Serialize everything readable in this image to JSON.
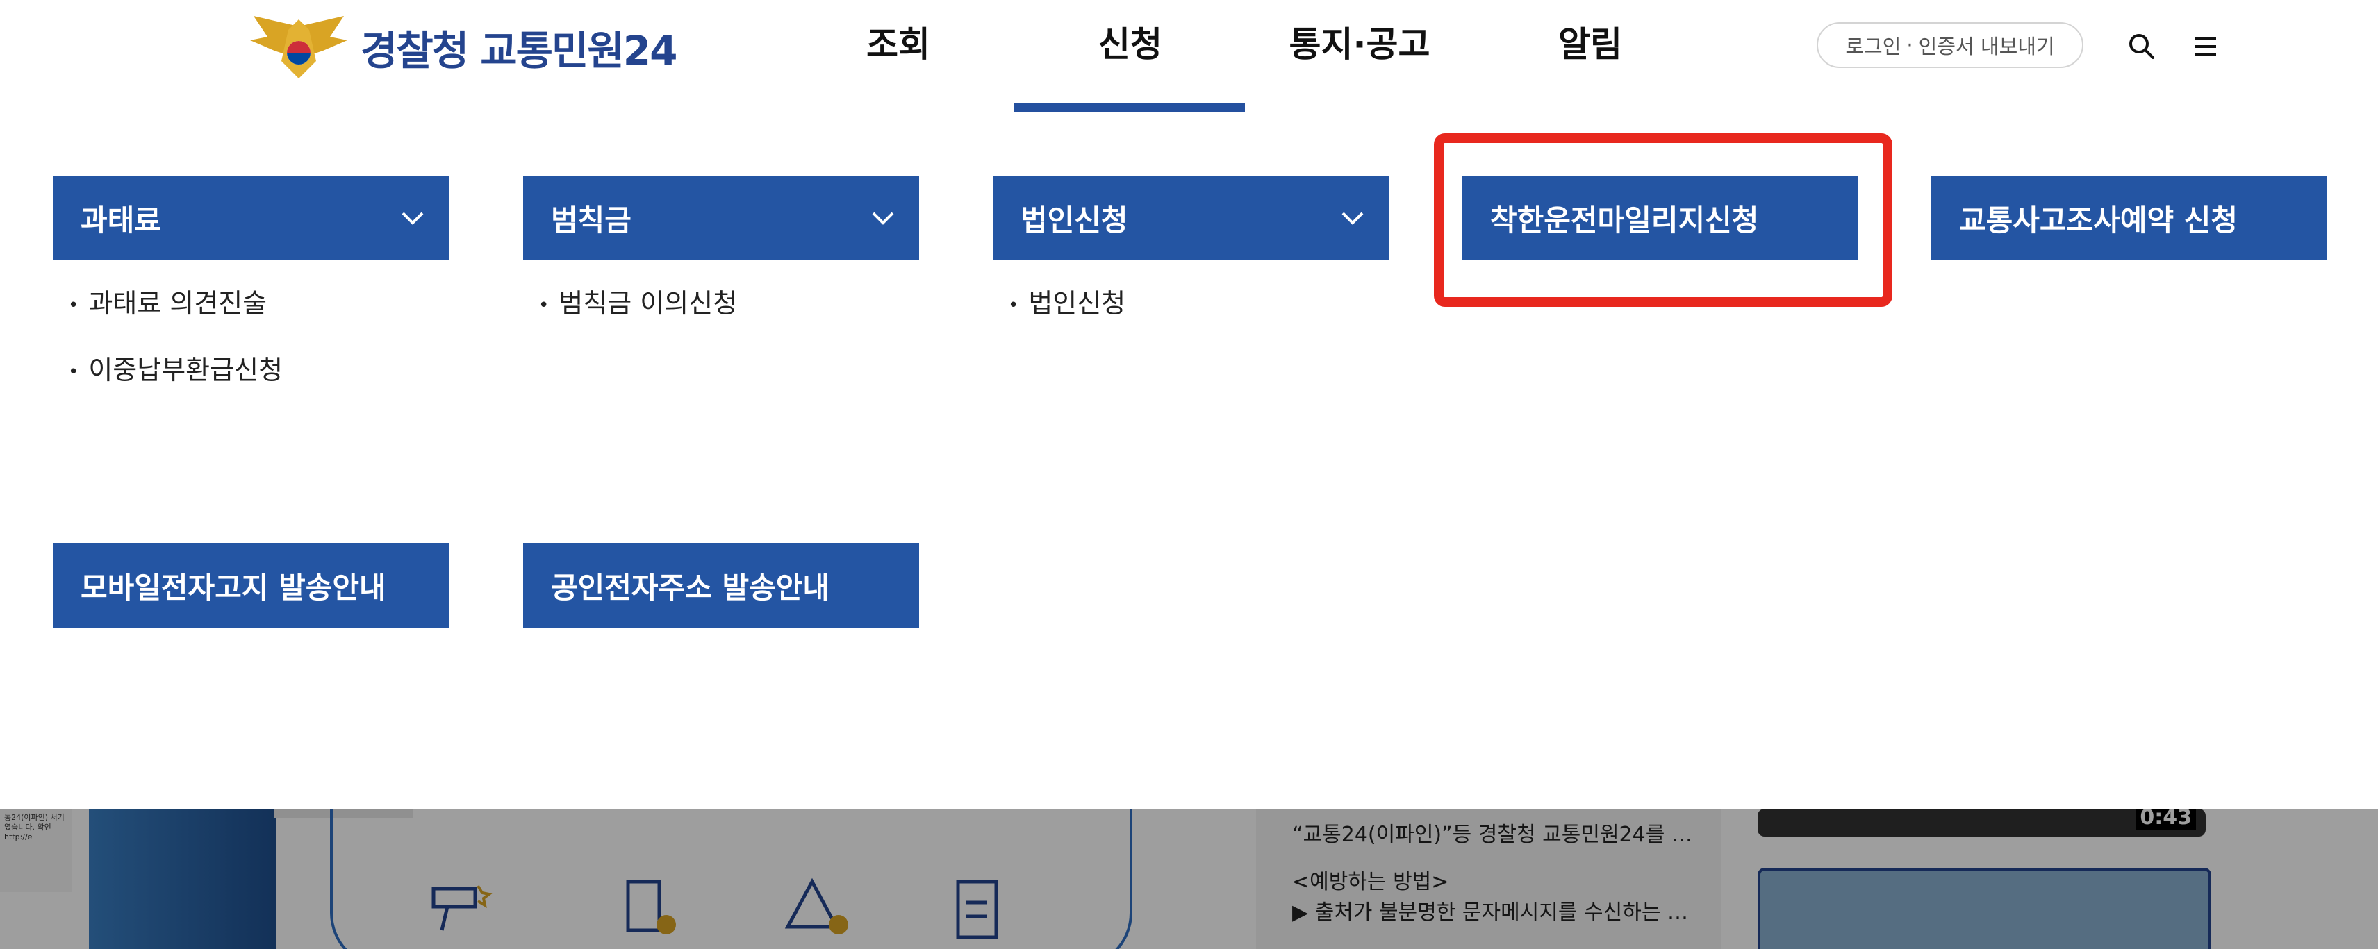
{
  "header": {
    "logo_text": "경찰청 교통민원24",
    "nav": [
      {
        "label": "조회"
      },
      {
        "label": "신청"
      },
      {
        "label": "통지·공고"
      },
      {
        "label": "알림"
      }
    ],
    "active_nav": "신청",
    "login_label": "로그인",
    "cert_label": "인증서 내보내기"
  },
  "mega_menu": {
    "row1": [
      {
        "title": "과태료",
        "items": [
          "과태료 의견진술",
          "이중납부환급신청"
        ]
      },
      {
        "title": "범칙금",
        "items": [
          "범칙금 이의신청"
        ]
      },
      {
        "title": "법인신청",
        "items": [
          "법인신청"
        ]
      },
      {
        "title": "착한운전마일리지신청",
        "items": []
      },
      {
        "title": "교통사고조사예약 신청",
        "items": []
      }
    ],
    "row2": [
      {
        "title": "모바일전자고지 발송안내"
      },
      {
        "title": "공인전자주소 발송안내"
      }
    ]
  },
  "background": {
    "news_lines": [
      "“교통24(이파인)”등 경찰청 교통민원24를 …",
      "<예방하는 방법>",
      "▶ 출처가 불분명한 문자메시지를 수신하는 …"
    ],
    "video_time": "0:43",
    "thumb_text": "통24(이파인) 서기 였습니다. 확인 http://e"
  },
  "colors": {
    "brand_blue": "#2455a3",
    "highlight_red": "#e8281e",
    "logo_blue": "#24448e"
  }
}
